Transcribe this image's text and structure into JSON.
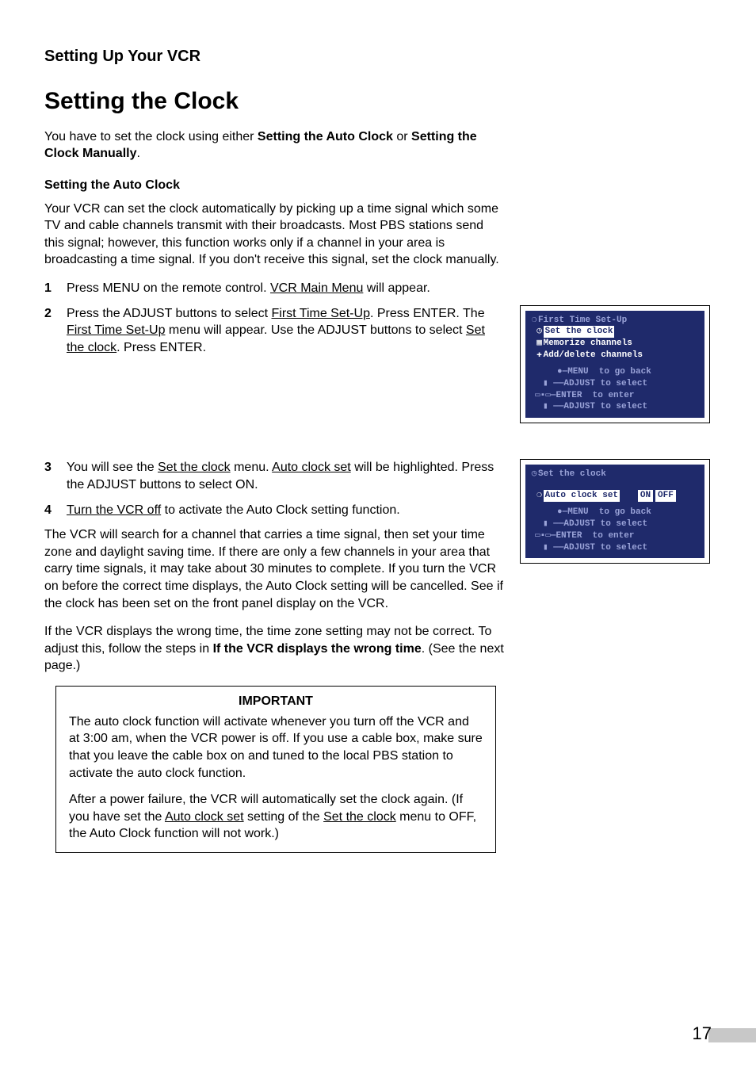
{
  "page": {
    "breadcrumb": "Setting Up Your VCR",
    "title": "Setting the Clock",
    "intro_pre": "You have to set the clock using either ",
    "intro_b1": "Setting the Auto Clock",
    "intro_mid": " or ",
    "intro_b2": "Setting the Clock Manually",
    "intro_post": ".",
    "sub": "Setting the Auto Clock",
    "para1": "Your VCR can set the clock automatically by picking up a time signal which some TV and cable channels transmit with their broadcasts.  Most PBS stations send this signal; however, this function works only if a channel in your area is broadcasting a time signal.  If you don't receive this signal, set the clock manually.",
    "step1_a": "Press MENU on the remote control.  ",
    "step1_u": "VCR Main Menu",
    "step1_b": " will appear.",
    "step2_a": "Press the ADJUST buttons to select ",
    "step2_u1": "First Time Set-Up",
    "step2_b": ".  Press ENTER.  The ",
    "step2_u2": "First Time Set-Up",
    "step2_c": " menu will appear.  Use the ADJUST buttons to select ",
    "step2_u3": "Set the clock",
    "step2_d": ".  Press ENTER.",
    "step3_a": "You will see the ",
    "step3_u1": "Set the clock",
    "step3_b": " menu.  ",
    "step3_u2": "Auto clock set",
    "step3_c": " will be highlighted.  Press the ADJUST buttons to select ON.",
    "step4_u": "Turn the VCR off",
    "step4_a": " to activate the Auto Clock setting function.",
    "para2": "The VCR will search for a channel that carries a time signal, then set your time zone and daylight saving time.  If there are only a few channels in your area that carry time signals, it may take about 30 minutes to complete.  If you turn the VCR on before the correct time displays, the Auto Clock setting will be cancelled.  See if the clock has been set on the front panel display on the VCR.",
    "para3_a": "If the VCR displays the wrong time, the time zone setting may not be correct.  To adjust this, follow the steps in ",
    "para3_b": "If the VCR displays the wrong time",
    "para3_c": ".  (See the next page.)",
    "important_title": "IMPORTANT",
    "important_p1": "The auto clock function will activate whenever you turn off the VCR and at 3:00 am, when the VCR power is off.  If you use a cable box, make sure that you leave the cable box on and tuned to the local PBS station to activate the auto clock function.",
    "important_p2_a": "After a power failure, the VCR will automatically set the clock again.  (If you have set the ",
    "important_p2_u1": "Auto clock set",
    "important_p2_b": " setting of the ",
    "important_p2_u2": "Set the clock",
    "important_p2_c": " menu to OFF, the Auto Clock function will not work.)",
    "pagenum": "17"
  },
  "osd1": {
    "title_icon": "❍",
    "title": "First Time Set-Up",
    "item1_icon": "◷",
    "item1": "Set the clock",
    "item2_icon": "▦",
    "item2": "Memorize channels",
    "item3_icon": "✚",
    "item3": "Add/delete channels",
    "hint1": "●—MENU  to go back",
    "hint2a": "▮ ——ADJUST to select",
    "hint2b": "▭▪▭—ENTER  to enter",
    "hint2c": "▮ ——ADJUST to select"
  },
  "osd2": {
    "title_icon": "◷",
    "title": "Set the clock",
    "item_icon": "❍",
    "item": "Auto clock set",
    "on": "ON",
    "off": "OFF",
    "hint1": "●—MENU  to go back",
    "hint2a": "▮ ——ADJUST to select",
    "hint2b": "▭▪▭—ENTER  to enter",
    "hint2c": "▮ ——ADJUST to select"
  }
}
